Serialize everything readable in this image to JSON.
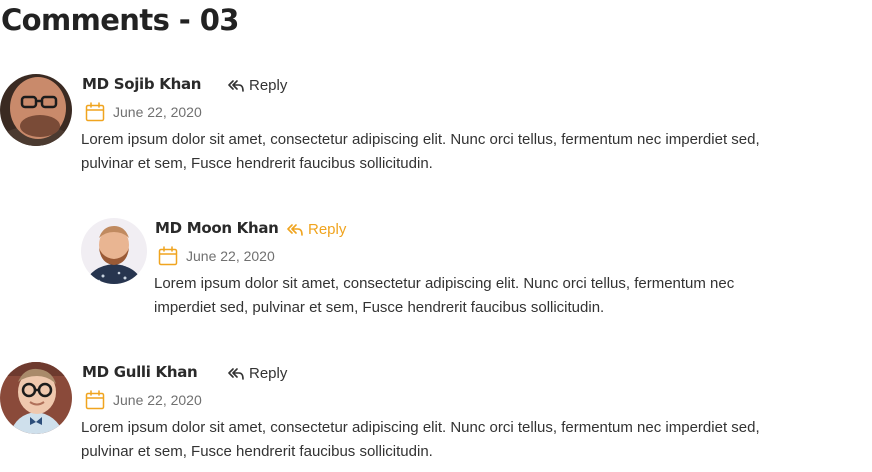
{
  "page": {
    "title": "Comments - 03"
  },
  "colors": {
    "accent": "#f0a41f",
    "text": "#333333",
    "muted": "#707070"
  },
  "icons": {
    "reply": "reply-arrow-icon",
    "date": "calendar-icon"
  },
  "comments": [
    {
      "author": "MD Sojib Khan",
      "reply_label": "Reply",
      "date": "June 22, 2020",
      "text": "Lorem ipsum dolor sit amet, consectetur adipiscing elit. Nunc orci tellus, fermentum nec imperdiet sed, pulvinar et sem, Fusce hendrerit faucibus sollicitudin.",
      "nested": false
    },
    {
      "author": "MD Moon Khan",
      "reply_label": "Reply",
      "date": "June 22, 2020",
      "text": "Lorem ipsum dolor sit amet, consectetur adipiscing elit. Nunc orci tellus, fermentum nec imperdiet sed, pulvinar et sem, Fusce hendrerit faucibus sollicitudin.",
      "nested": true
    },
    {
      "author": "MD Gulli Khan",
      "reply_label": "Reply",
      "date": "June 22, 2020",
      "text": "Lorem ipsum dolor sit amet, consectetur adipiscing elit. Nunc orci tellus, fermentum nec imperdiet sed, pulvinar et sem, Fusce hendrerit faucibus sollicitudin.",
      "nested": false
    }
  ]
}
